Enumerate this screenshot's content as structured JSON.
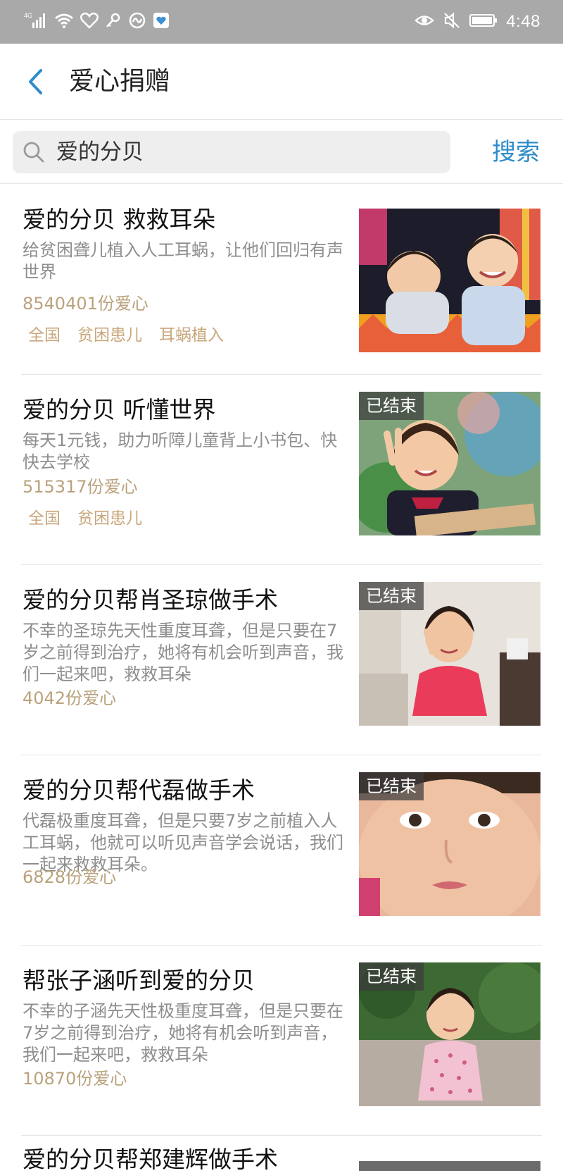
{
  "status_bar": {
    "network": "4G",
    "time": "4:48"
  },
  "header": {
    "title": "爱心捐赠"
  },
  "search": {
    "query": "爱的分贝",
    "button_label": "搜索"
  },
  "items": [
    {
      "title": "爱的分贝 救救耳朵",
      "description": "给贫困聋儿植入人工耳蜗，让他们回归有声世界",
      "count": "8540401份爱心",
      "tags": [
        "全国",
        "贫困患儿",
        "耳蜗植入"
      ],
      "badge": ""
    },
    {
      "title": "爱的分贝 听懂世界",
      "description": "每天1元钱，助力听障儿童背上小书包、快快去学校",
      "count": "515317份爱心",
      "tags": [
        "全国",
        "贫困患儿"
      ],
      "badge": "已结束"
    },
    {
      "title": "爱的分贝帮肖圣琼做手术",
      "description": "不幸的圣琼先天性重度耳聋，但是只要在7岁之前得到治疗，她将有机会听到声音，我们一起来吧，救救耳朵",
      "count": "4042份爱心",
      "tags": [],
      "badge": "已结束"
    },
    {
      "title": "爱的分贝帮代磊做手术",
      "description": "代磊极重度耳聋，但是只要7岁之前植入人工耳蜗，他就可以听见声音学会说话，我们一起来救救耳朵。",
      "count": "6828份爱心",
      "tags": [],
      "badge": "已结束"
    },
    {
      "title": "帮张子涵听到爱的分贝",
      "description": "不幸的子涵先天性极重度耳聋，但是只要在7岁之前得到治疗，她将有机会听到声音，我们一起来吧，救救耳朵",
      "count": "10870份爱心",
      "tags": [],
      "badge": "已结束"
    }
  ],
  "partial_item": {
    "title": "爱的分贝帮郑建辉做手术"
  },
  "colors": {
    "status_bar": "#a9a9a9",
    "accent_blue": "#2d8ccb",
    "count_text": "#b9a27c",
    "tag_text": "#c9a77c"
  }
}
